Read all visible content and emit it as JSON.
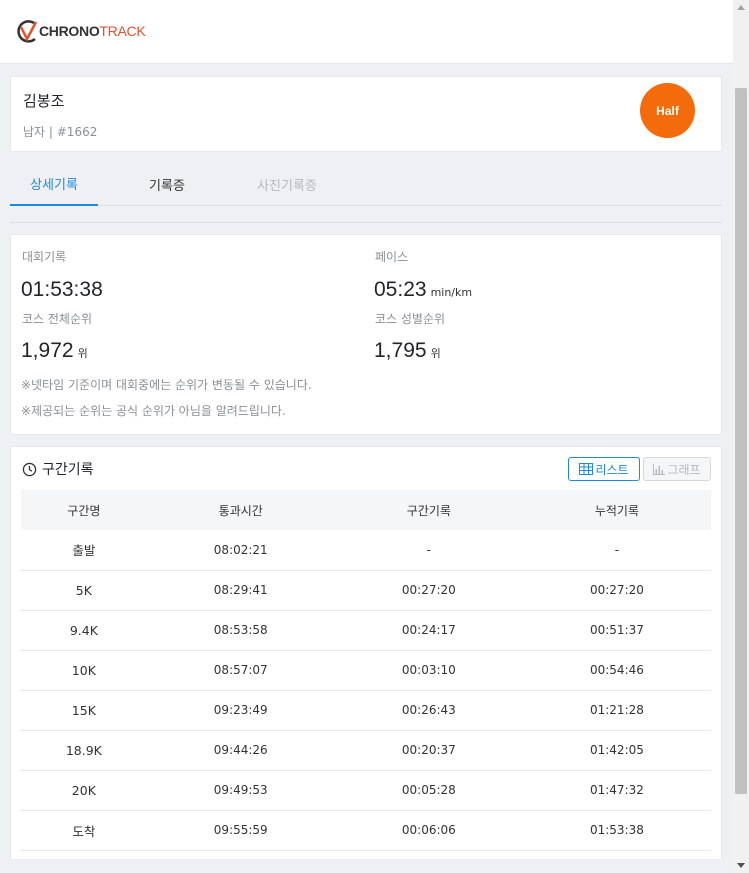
{
  "header": {
    "logo_part1": "CHRONO",
    "logo_part2": "TRACK"
  },
  "runner": {
    "name": "김봉조",
    "sub": "남자 | #1662",
    "badge": "Half"
  },
  "tabs": [
    {
      "label": "상세기록"
    },
    {
      "label": "기록증"
    },
    {
      "label": "사진기록증"
    }
  ],
  "record": {
    "race_label": "대회기록",
    "race_value": "01:53:38",
    "pace_label": "페이스",
    "pace_value": "05:23",
    "pace_unit": "min/km",
    "overall_label": "코스 전체순위",
    "overall_value": "1,972",
    "overall_unit": "위",
    "gender_label": "코스 성별순위",
    "gender_value": "1,795",
    "gender_unit": "위",
    "note1": "※넷타임 기준이며 대회중에는 순위가 변동될 수 있습니다.",
    "note2": "※제공되는 순위는 공식 순위가 아님을 알려드립니다."
  },
  "splits": {
    "title": "구간기록",
    "list_button": "리스트",
    "graph_button": "그래프",
    "columns": [
      "구간명",
      "통과시간",
      "구간기록",
      "누적기록"
    ],
    "rows": [
      [
        "출발",
        "08:02:21",
        "-",
        "-"
      ],
      [
        "5K",
        "08:29:41",
        "00:27:20",
        "00:27:20"
      ],
      [
        "9.4K",
        "08:53:58",
        "00:24:17",
        "00:51:37"
      ],
      [
        "10K",
        "08:57:07",
        "00:03:10",
        "00:54:46"
      ],
      [
        "15K",
        "09:23:49",
        "00:26:43",
        "01:21:28"
      ],
      [
        "18.9K",
        "09:44:26",
        "00:20:37",
        "01:42:05"
      ],
      [
        "20K",
        "09:49:53",
        "00:05:28",
        "01:47:32"
      ],
      [
        "도착",
        "09:55:59",
        "00:06:06",
        "01:53:38"
      ]
    ]
  },
  "colors": {
    "accent": "#1e88e5",
    "badge": "#f36b0b",
    "brand": "#e8502a"
  }
}
